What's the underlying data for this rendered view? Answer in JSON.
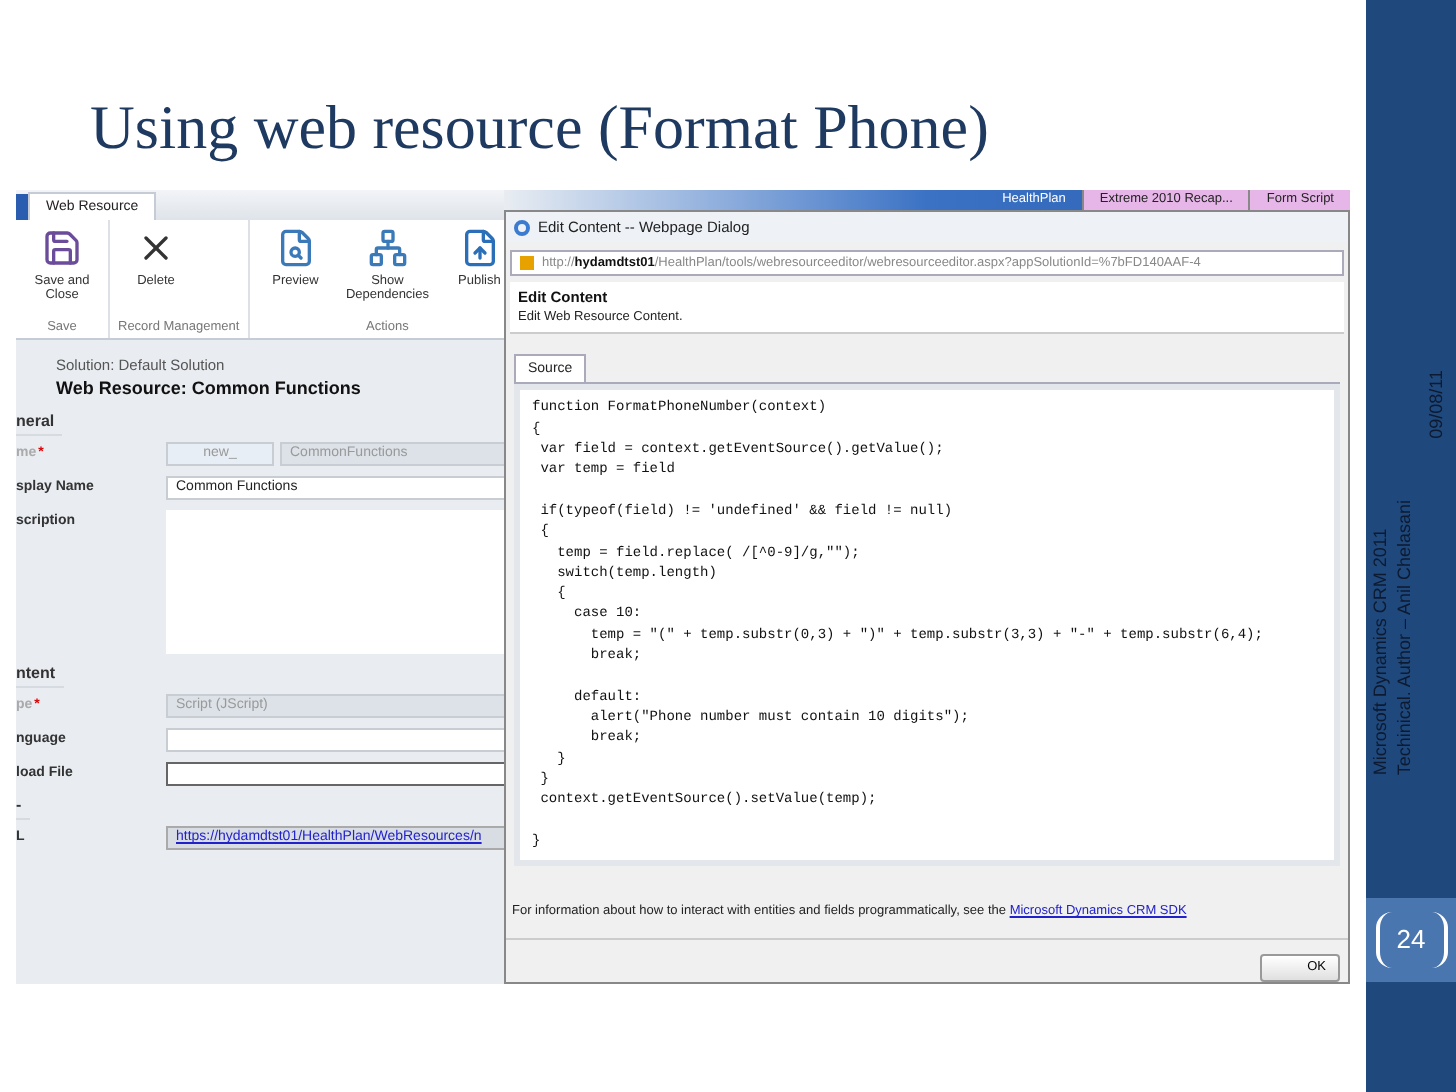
{
  "slide": {
    "title": "Using web resource (Format Phone)",
    "date": "09/08/11",
    "footer_lines": [
      "Microsoft Dynamics CRM 2011",
      "Techinical. Author – Anil Chelasani"
    ],
    "page_number": "24"
  },
  "taskbar": [
    {
      "label": "HealthPlan",
      "selected": true
    },
    {
      "label": "Extreme 2010 Recap...",
      "selected": false
    },
    {
      "label": "Form Script",
      "selected": false
    }
  ],
  "form": {
    "ribbon_tab": "Web Resource",
    "ribbon_groups": [
      {
        "label": "Save",
        "buttons": [
          {
            "label": "Save and Close",
            "kind": "save"
          }
        ]
      },
      {
        "label": "Record Management",
        "buttons": [
          {
            "label": "Delete",
            "kind": "delete"
          }
        ]
      },
      {
        "label": "Actions",
        "buttons": [
          {
            "label": "Preview",
            "kind": "preview"
          },
          {
            "label": "Show Dependencies",
            "kind": "dependencies"
          },
          {
            "label": "Publish",
            "kind": "publish"
          }
        ]
      }
    ],
    "solution": "Solution: Default Solution",
    "heading": "Web Resource: Common Functions",
    "sections": [
      {
        "title": "neral",
        "rows": [
          {
            "label": "me",
            "required_mark": "*",
            "kind": "split",
            "prefix": "new_",
            "value": "CommonFunctions",
            "disabled": true
          },
          {
            "label": "splay Name",
            "kind": "text",
            "value": "Common Functions",
            "disabled": false
          },
          {
            "label": "scription",
            "kind": "textarea",
            "disabled": false
          }
        ]
      },
      {
        "title": "ntent",
        "rows": [
          {
            "label": "pe",
            "required_mark": "*",
            "kind": "text",
            "value": "Script (JScript)",
            "disabled": true
          },
          {
            "label": "nguage",
            "kind": "text",
            "disabled": false
          },
          {
            "label": "load File",
            "kind": "file",
            "disabled": false
          }
        ]
      },
      {
        "title": "-",
        "rows": [
          {
            "label": "L",
            "kind": "link",
            "value": "https://hydamdtst01/HealthPlan/WebResources/n",
            "disabled": false
          }
        ]
      }
    ]
  },
  "dialog": {
    "title": "Edit Content -- Webpage Dialog",
    "address": "http://**hydamdtst01**/HealthPlan/tools/webresourceeditor/webresourceeditor.aspx?appSolutionId=%7bFD140AAF-4",
    "heading": "Edit Content",
    "subtitle": "Edit Web Resource Content.",
    "tabs": [
      {
        "label": "Source",
        "selected": true
      }
    ],
    "code": "function FormatPhoneNumber(context)\n{\n var field = context.getEventSource().getValue();\n var temp = field\n\n if(typeof(field) != 'undefined' && field != null)\n {\n   temp = field.replace( /[^0-9]/g,\"\");\n   switch(temp.length)\n   {\n     case 10:\n       temp = \"(\" + temp.substr(0,3) + \")\" + temp.substr(3,3) + \"-\" + temp.substr(6,4);\n       break;\n\n     default:\n       alert(\"Phone number must contain 10 digits\");\n       break;\n   }\n }\n context.getEventSource().setValue(temp);\n\n}",
    "info": "For information about how to interact with entities and fields programmatically, see the",
    "info_link": "Microsoft Dynamics CRM SDK",
    "button": "OK"
  }
}
